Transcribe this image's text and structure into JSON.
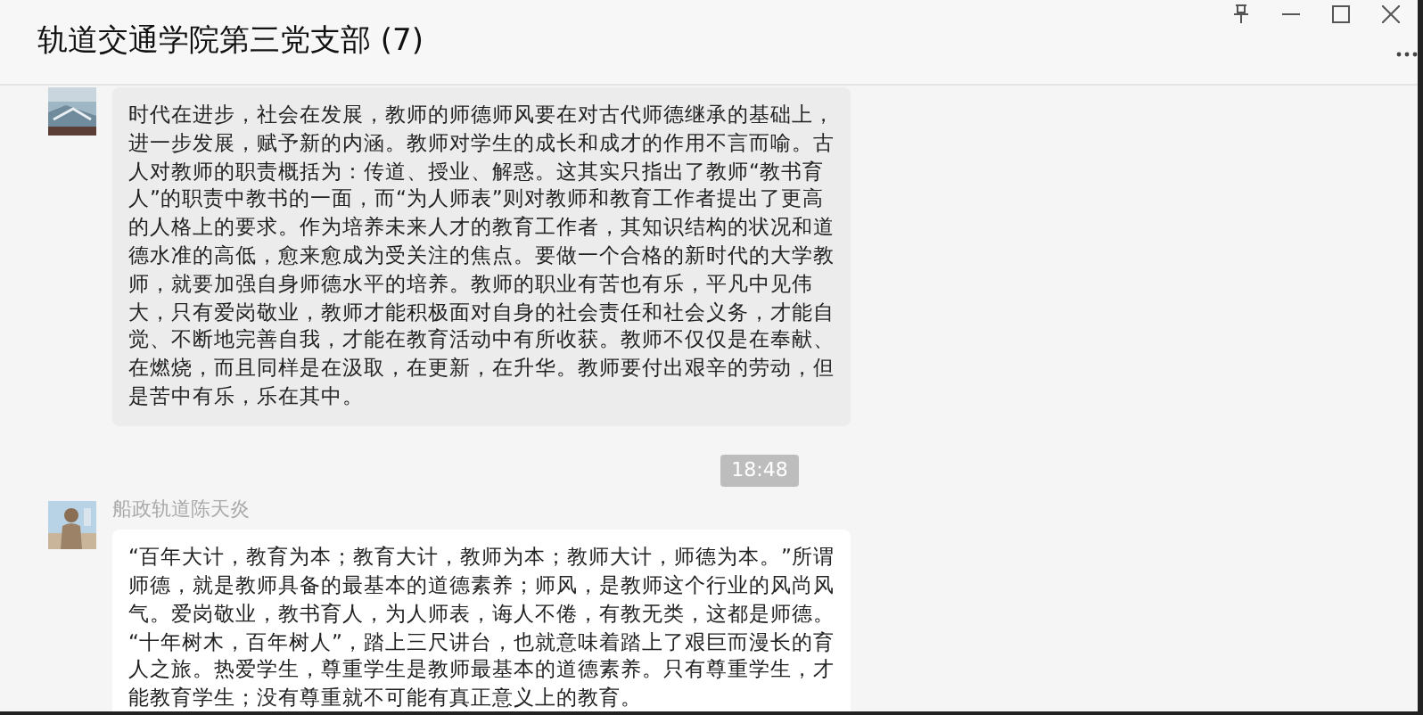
{
  "window": {
    "title": "轨道交通学院第三党支部 (7)"
  },
  "messages": [
    {
      "kind": "message",
      "text": "时代在进步，社会在发展，教师的师德师风要在对古代师德继承的基础上，进一步发展，赋予新的内涵。教师对学生的成长和成才的作用不言而喻。古人对教师的职责概括为：传道、授业、解惑。这其实只指出了教师“教书育人”的职责中教书的一面，而“为人师表”则对教师和教育工作者提出了更高的人格上的要求。作为培养未来人才的教育工作者，其知识结构的状况和道德水准的高低，愈来愈成为受关注的焦点。要做一个合格的新时代的大学教师，就要加强自身师德水平的培养。教师的职业有苦也有乐，平凡中见伟大，只有爱岗敬业，教师才能积极面对自身的社会责任和社会义务，才能自觉、不断地完善自我，才能在教育活动中有所收获。教师不仅仅是在奉献、在燃烧，而且同样是在汲取，在更新，在升华。教师要付出艰辛的劳动，但是苦中有乐，乐在其中。"
    },
    {
      "kind": "time",
      "text": "18:48"
    },
    {
      "kind": "message",
      "sender": "船政轨道陈天炎",
      "text": "“百年大计，教育为本；教育大计，教师为本；教师大计，师德为本。”所谓师德，就是教师具备的最基本的道德素养；师风，是教师这个行业的风尚风气。爱岗敬业，教书育人，为人师表，诲人不倦，有教无类，这都是师德。 “十年树木，百年树人”，踏上三尺讲台，也就意味着踏上了艰巨而漫长的育人之旅。热爱学生，尊重学生是教师最基本的道德素养。只有尊重学生，才能教育学生；没有尊重就不可能有真正意义上的教育。"
    }
  ]
}
